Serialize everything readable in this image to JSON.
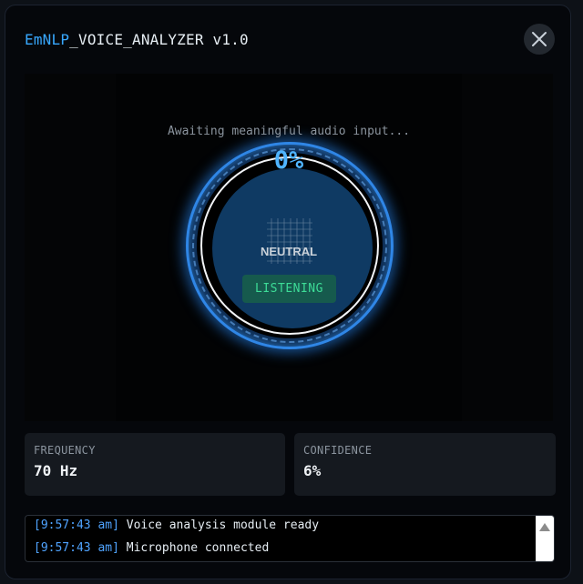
{
  "header": {
    "brand": "EmNLP",
    "title_rest": "_VOICE_ANALYZER v1.0",
    "close_icon": "close-icon"
  },
  "visualizer": {
    "status_text": "Awaiting meaningful audio input...",
    "percent": "0%",
    "emotion": "NEUTRAL",
    "state_badge": "LISTENING",
    "accent_color": "#2f86e6",
    "badge_color": "#3ddc97"
  },
  "stats": {
    "frequency": {
      "label": "FREQUENCY",
      "value": "70 Hz"
    },
    "confidence": {
      "label": "CONFIDENCE",
      "value": "6%"
    }
  },
  "log": {
    "entries": [
      {
        "time": "[9:57:43 am]",
        "message": "Voice analysis module ready"
      },
      {
        "time": "[9:57:43 am]",
        "message": "Microphone connected"
      }
    ]
  }
}
